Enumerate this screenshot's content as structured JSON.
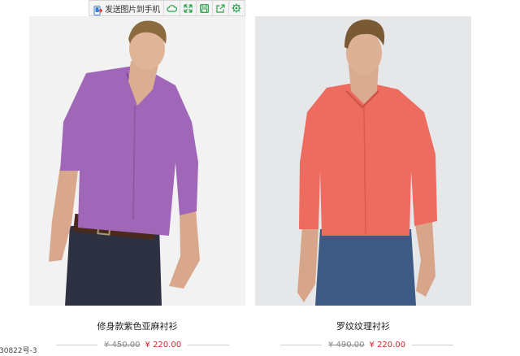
{
  "toolbar": {
    "send_label": "发送图片到手机",
    "icons": [
      "phone-send-icon",
      "cloud-icon",
      "expand-icon",
      "save-icon",
      "share-icon",
      "settings-icon"
    ],
    "accent_color": "#2aa14c"
  },
  "products": [
    {
      "name": "修身款紫色亚麻衬衫",
      "old_price": "¥ 450.00",
      "new_price": "¥ 220.00",
      "shirt_color": "#a067b8"
    },
    {
      "name": "罗纹纹理衬衫",
      "old_price": "¥ 490.00",
      "new_price": "¥ 220.00",
      "shirt_color": "#ee6b60"
    }
  ],
  "footer_code": "30822号-3",
  "colors": {
    "price_new": "#d2262c",
    "price_old": "#888888"
  }
}
